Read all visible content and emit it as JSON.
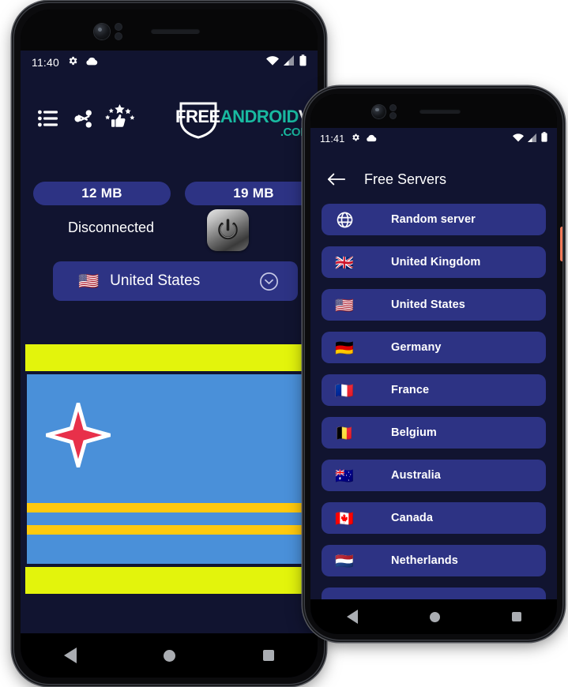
{
  "phone1": {
    "status_bar": {
      "time": "11:40",
      "left_icons": [
        "gear-icon",
        "cloud-icon"
      ],
      "right_icons": [
        "wifi-icon",
        "signal-icon",
        "battery-icon"
      ]
    },
    "toolbar": {
      "icons": [
        {
          "name": "list-menu-icon",
          "label": "Menu"
        },
        {
          "name": "share-icon",
          "label": "Share"
        },
        {
          "name": "rate-us-icon",
          "label": "Rate us"
        }
      ]
    },
    "logo": {
      "part1": "FREE",
      "part2": "ANDROID",
      "part3": "VPN",
      "part4": ".COM",
      "color_white": "#ffffff",
      "color_teal": "#19b9a0"
    },
    "stats": {
      "download": "12 MB",
      "upload": "19 MB"
    },
    "connection": {
      "status": "Disconnected",
      "power_button_label": "power-toggle"
    },
    "selected_server": {
      "flag": "🇺🇸",
      "name": "United States",
      "chevron": "chevron-down-icon"
    },
    "banner": {
      "top_bar_color": "#e3f40c",
      "bottom_bar_color": "#e3f40c",
      "flag_name": "Aruba",
      "flag_field_color": "#4a90d9",
      "flag_stripe_color": "#ffc90e",
      "flag_star_color": "#e8304a"
    },
    "nav": {
      "back": "back-nav",
      "home": "home-nav",
      "recents": "recents-nav"
    }
  },
  "phone2": {
    "status_bar": {
      "time": "11:41",
      "left_icons": [
        "gear-icon",
        "cloud-icon"
      ],
      "right_icons": [
        "wifi-icon",
        "signal-icon",
        "battery-icon"
      ]
    },
    "appbar": {
      "back": "back-arrow-icon",
      "title": "Free Servers"
    },
    "servers": [
      {
        "icon": "globe-icon",
        "flag": "",
        "name": "Random server"
      },
      {
        "icon": "flag",
        "flag": "🇬🇧",
        "name": "United Kingdom"
      },
      {
        "icon": "flag",
        "flag": "🇺🇸",
        "name": "United States"
      },
      {
        "icon": "flag",
        "flag": "🇩🇪",
        "name": "Germany"
      },
      {
        "icon": "flag",
        "flag": "🇫🇷",
        "name": "France"
      },
      {
        "icon": "flag",
        "flag": "🇧🇪",
        "name": "Belgium"
      },
      {
        "icon": "flag",
        "flag": "🇦🇺",
        "name": "Australia"
      },
      {
        "icon": "flag",
        "flag": "🇨🇦",
        "name": "Canada"
      },
      {
        "icon": "flag",
        "flag": "🇳🇱",
        "name": "Netherlands"
      },
      {
        "icon": "flag",
        "flag": "",
        "name": ""
      }
    ],
    "side_button_color": "#f07a5a",
    "nav": {
      "back": "back-nav",
      "home": "home-nav",
      "recents": "recents-nav"
    }
  },
  "theme": {
    "screen_bg": "#111430",
    "accent_blue": "#2d3384",
    "text_white": "#ffffff"
  }
}
